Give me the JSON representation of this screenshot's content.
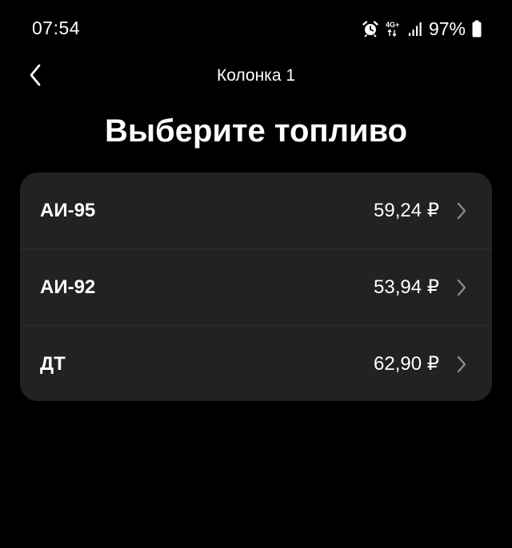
{
  "status_bar": {
    "time": "07:54",
    "network_label": "4G+",
    "battery_percent": "97%",
    "icons": [
      "alarm-icon",
      "network-4g-icon",
      "signal-icon",
      "battery-icon"
    ]
  },
  "header": {
    "back_icon": "chevron-left-icon",
    "title": "Колонка 1"
  },
  "main": {
    "title": "Выберите топливо",
    "fuels": [
      {
        "name": "АИ-95",
        "price": "59,24 ₽"
      },
      {
        "name": "АИ-92",
        "price": "53,94 ₽"
      },
      {
        "name": "ДТ",
        "price": "62,90 ₽"
      }
    ]
  },
  "colors": {
    "background": "#000000",
    "card": "#222222",
    "text": "#ffffff",
    "chevron": "#8a8a8a"
  }
}
